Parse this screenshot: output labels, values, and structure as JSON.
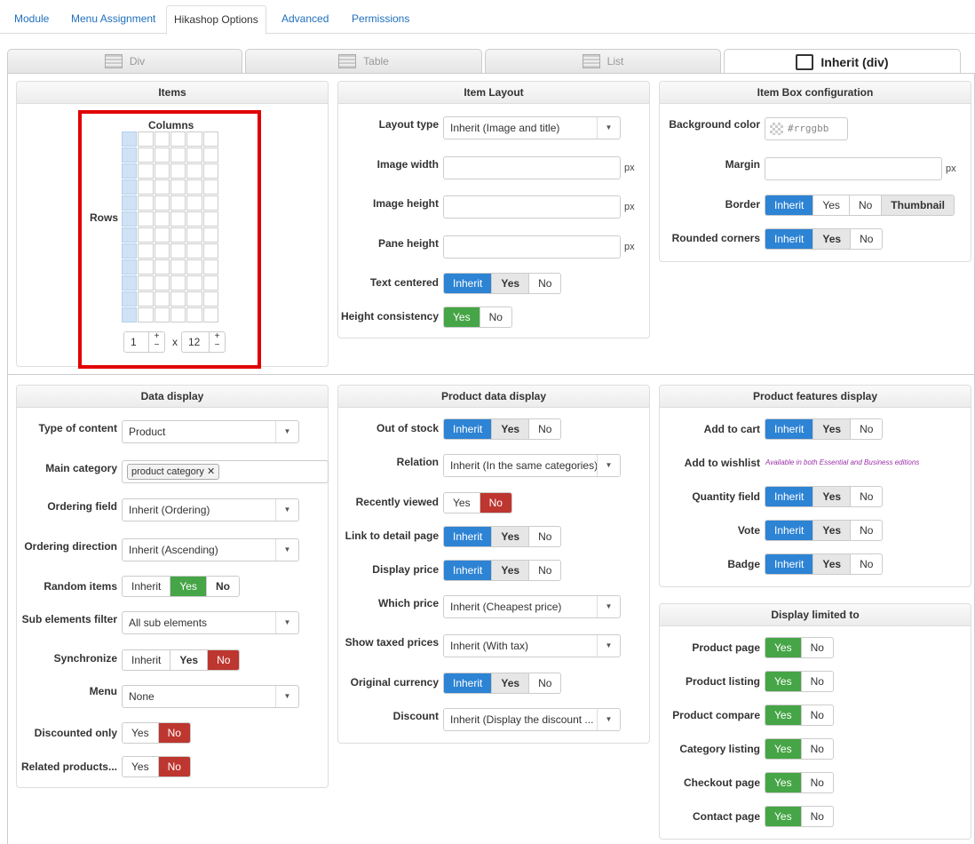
{
  "nav_tabs": [
    "Module",
    "Menu Assignment",
    "Hikashop Options",
    "Advanced",
    "Permissions"
  ],
  "layout_tabs": [
    "Div",
    "Table",
    "List",
    "Inherit (div)"
  ],
  "items": {
    "title": "Items",
    "columns_label": "Columns",
    "rows_label": "Rows",
    "columns_value": "1",
    "times": "x",
    "rows_value": "12",
    "plus": "+",
    "minus": "−"
  },
  "item_layout": {
    "title": "Item Layout",
    "layout_type_label": "Layout type",
    "layout_type_value": "Inherit (Image and title)",
    "image_width_label": "Image width",
    "image_height_label": "Image height",
    "pane_height_label": "Pane height",
    "px": "px",
    "text_centered_label": "Text centered",
    "height_consistency_label": "Height consistency"
  },
  "item_box": {
    "title": "Item Box configuration",
    "bg_label": "Background color",
    "bg_placeholder": "#rrggbb",
    "margin_label": "Margin",
    "px": "px",
    "border_label": "Border",
    "rounded_label": "Rounded corners"
  },
  "buttons": {
    "inherit": "Inherit",
    "yes": "Yes",
    "no": "No",
    "thumbnail": "Thumbnail"
  },
  "data_display": {
    "title": "Data display",
    "type_label": "Type of content",
    "type_value": "Product",
    "main_cat_label": "Main category",
    "main_cat_tag": "product category",
    "ordering_field_label": "Ordering field",
    "ordering_field_value": "Inherit (Ordering)",
    "ordering_dir_label": "Ordering direction",
    "ordering_dir_value": "Inherit (Ascending)",
    "random_label": "Random items",
    "sub_label": "Sub elements filter",
    "sub_value": "All sub elements",
    "sync_label": "Synchronize",
    "menu_label": "Menu",
    "menu_value": "None",
    "discounted_label": "Discounted only",
    "related_label": "Related products..."
  },
  "product_data": {
    "title": "Product data display",
    "out_of_stock_label": "Out of stock",
    "relation_label": "Relation",
    "relation_value": "Inherit (In the same categories)",
    "recently_label": "Recently viewed",
    "link_label": "Link to detail page",
    "display_price_label": "Display price",
    "which_price_label": "Which price",
    "which_price_value": "Inherit (Cheapest price)",
    "taxed_label": "Show taxed prices",
    "taxed_value": "Inherit (With tax)",
    "original_label": "Original currency",
    "discount_label": "Discount",
    "discount_value": "Inherit (Display the discount ..."
  },
  "features": {
    "title": "Product features display",
    "add_cart_label": "Add to cart",
    "wishlist_label": "Add to wishlist",
    "wishlist_note": "Available in both Essential and Business editions",
    "quantity_label": "Quantity field",
    "vote_label": "Vote",
    "badge_label": "Badge"
  },
  "limited": {
    "title": "Display limited to",
    "labels": [
      "Product page",
      "Product listing",
      "Product compare",
      "Category listing",
      "Checkout page",
      "Contact page"
    ]
  },
  "colors": {
    "blue": "#2d83d4",
    "green": "#46a546",
    "red": "#bd362f",
    "highlight_border": "#e00000"
  }
}
